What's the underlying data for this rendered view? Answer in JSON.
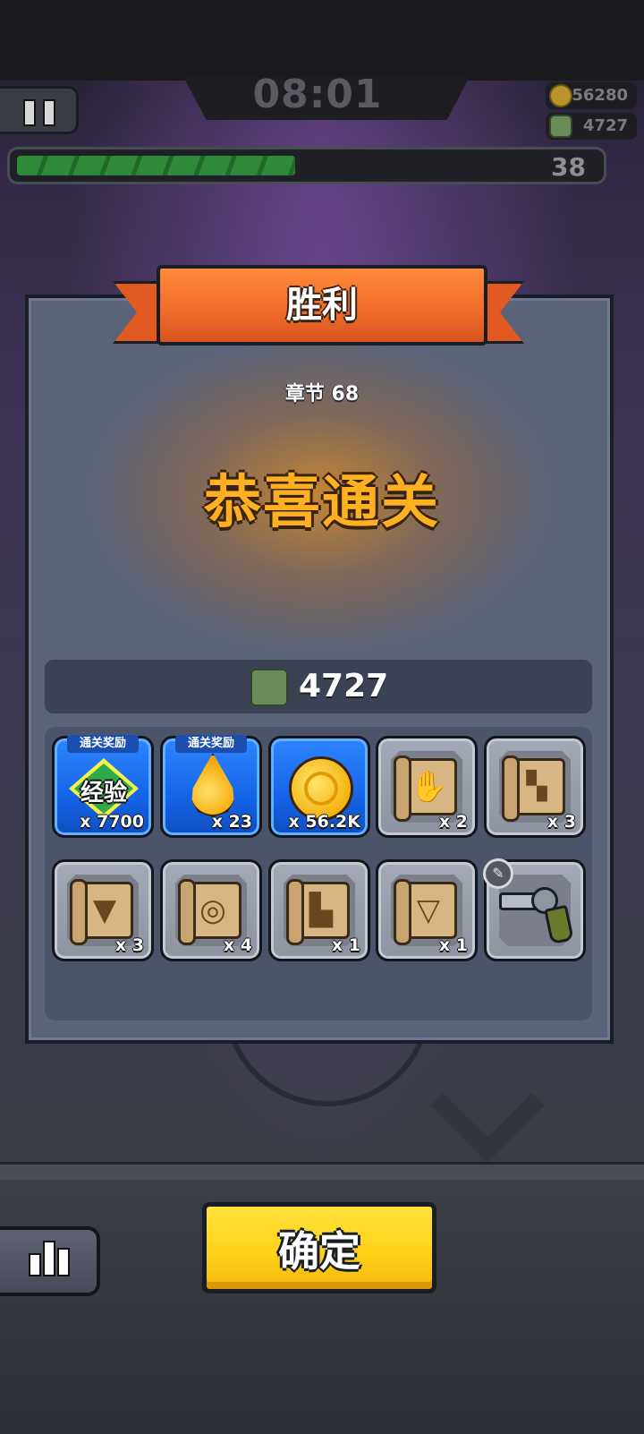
{
  "hud": {
    "timer": "08:01",
    "coins": "56280",
    "kills": "4727",
    "xp_progress": 0.48,
    "level": "38"
  },
  "victory": {
    "title": "胜利",
    "chapter": "章节 68",
    "message": "恭喜通关",
    "kill_count": "4727"
  },
  "rewards": [
    {
      "tag": "通关奖励",
      "icon": "exp-icon",
      "icon_text": "经验",
      "qty": "x 7700",
      "rarity": "blue"
    },
    {
      "tag": "通关奖励",
      "icon": "gold-drop-icon",
      "qty": "x 23",
      "rarity": "blue"
    },
    {
      "icon": "gold-coin-icon",
      "qty": "x 56.2K",
      "rarity": "blue"
    },
    {
      "icon": "glove-blueprint-icon",
      "qty": "x 2",
      "rarity": "grey"
    },
    {
      "icon": "gun-blueprint-icon",
      "qty": "x 3",
      "rarity": "grey"
    },
    {
      "icon": "armor-blueprint-icon",
      "qty": "x 3",
      "rarity": "grey"
    },
    {
      "icon": "belt-blueprint-icon",
      "qty": "x 4",
      "rarity": "grey"
    },
    {
      "icon": "boots-blueprint-icon",
      "qty": "x 1",
      "rarity": "grey"
    },
    {
      "icon": "necklace-blueprint-icon",
      "qty": "x 1",
      "rarity": "grey"
    },
    {
      "icon": "revolver-icon",
      "rarity": "grey"
    }
  ],
  "buttons": {
    "confirm": "确定"
  },
  "colors": {
    "ribbon": "#f06a28",
    "congrats": "#ffb020",
    "confirm": "#ffd21a",
    "reward_blue": "#1564e8"
  }
}
